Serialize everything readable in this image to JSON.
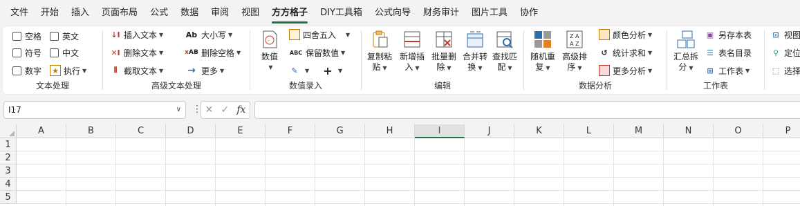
{
  "menu": [
    "文件",
    "开始",
    "插入",
    "页面布局",
    "公式",
    "数据",
    "审阅",
    "视图",
    "方方格子",
    "DIY工具箱",
    "公式向导",
    "财务审计",
    "图片工具",
    "协作"
  ],
  "active_menu": "方方格子",
  "ribbon": {
    "text_proc": {
      "label": "文本处理",
      "space": "空格",
      "english": "英文",
      "symbol": "符号",
      "chinese": "中文",
      "number": "数字",
      "execute": "执行"
    },
    "adv_text": {
      "label": "高级文本处理",
      "insert": "插入文本",
      "delete": "删除文本",
      "extract": "截取文本",
      "case": "大小写",
      "del_space": "删除空格",
      "more": "更多"
    },
    "num_entry": {
      "label": "数值录入",
      "value": "数值",
      "round": "四舍五入",
      "keep": "保留数值"
    },
    "edit": {
      "label": "编辑",
      "copy_paste": [
        "复制粘",
        "贴"
      ],
      "new_insert": [
        "新增插",
        "入"
      ],
      "batch_delete": [
        "批量删",
        "除"
      ],
      "merge": [
        "合并转",
        "换"
      ],
      "find": [
        "查找匹",
        "配"
      ]
    },
    "data_analysis": {
      "label": "数据分析",
      "random": [
        "随机重",
        "复"
      ],
      "sort": [
        "高级排",
        "序"
      ],
      "color": "颜色分析",
      "stats": "统计求和",
      "more": "更多分析"
    },
    "worksheet": {
      "label": "工作表",
      "summary": [
        "汇总拆",
        "分"
      ],
      "save_as": "另存本表",
      "catalog": "表名目录",
      "sheet": "工作表"
    },
    "view": {
      "view": "视图",
      "locate": "定位",
      "select": "选择"
    }
  },
  "formula_bar": {
    "name_box": "I17",
    "fx": "fx",
    "value": ""
  },
  "columns": [
    "A",
    "B",
    "C",
    "D",
    "E",
    "F",
    "G",
    "H",
    "I",
    "J",
    "K",
    "L",
    "M",
    "N",
    "O",
    "P"
  ],
  "selected_column": "I",
  "rows": [
    "1",
    "2",
    "3",
    "4",
    "5"
  ],
  "accent": "#217346"
}
